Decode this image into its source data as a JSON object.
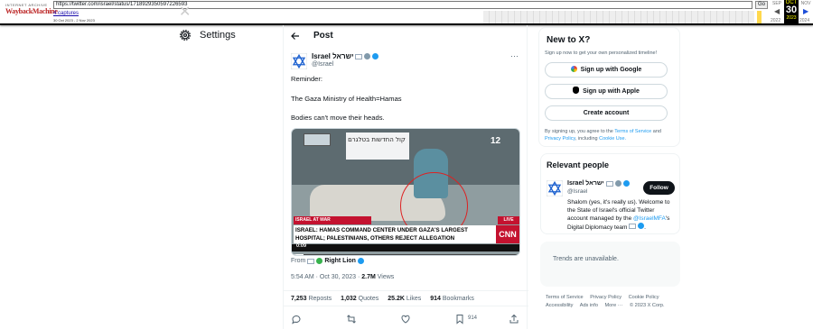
{
  "wayback": {
    "logo_top": "INTERNET ARCHIVE",
    "logo_main": "WaybackMachine",
    "url": "https://twitter.com/israel/status/1718929350597226593",
    "go_label": "Go",
    "captures": "4 captures",
    "range": "30 Oct 2023 - 2 Nov 2023",
    "cal": {
      "prev_month": "SEP",
      "cur_month": "OCT",
      "next_month": "NOV",
      "day": "30",
      "prev_year": "2022",
      "cur_year": "2023",
      "next_year": "2024"
    }
  },
  "left": {
    "settings_label": "Settings"
  },
  "post": {
    "header_title": "Post",
    "author_name": "Israel ישראל",
    "author_handle": "@Israel",
    "lines": [
      "Reminder:",
      "The Gaza Ministry of Health=Hamas",
      "Bodies can't move their heads."
    ],
    "media": {
      "hebrew_caption": "קול החדשות בטלגרם",
      "channel": "12",
      "war_banner": "ISRAEL AT WAR",
      "live": "LIVE",
      "headline": "ISRAEL: HAMAS COMMAND CENTER UNDER GAZA'S LARGEST HOSPITAL; PALESTINIANS, OTHERS REJECT ALLEGATION",
      "network": "CNN",
      "time": "0:09",
      "progress": 0.05
    },
    "from_label": "From",
    "from_source": "Right Lion",
    "time": "5:54 AM",
    "date": "Oct 30, 2023",
    "views_count": "2.7M",
    "views_label": "Views",
    "stats": [
      {
        "count": "7,253",
        "label": "Reposts"
      },
      {
        "count": "1,032",
        "label": "Quotes"
      },
      {
        "count": "25.2K",
        "label": "Likes"
      },
      {
        "count": "914",
        "label": "Bookmarks"
      }
    ],
    "bookmark_count": "914"
  },
  "signup": {
    "title": "New to X?",
    "subtitle": "Sign up now to get your own personalized timeline!",
    "google": "Sign up with Google",
    "apple": "Sign up with Apple",
    "create": "Create account",
    "fine_1": "By signing up, you agree to the",
    "fine_terms": "Terms of Service",
    "fine_2": "and",
    "fine_privacy": "Privacy Policy",
    "fine_3": ", including",
    "fine_cookie": "Cookie Use."
  },
  "people": {
    "title": "Relevant people",
    "name": "Israel ישראל",
    "handle": "@Israel",
    "follow": "Follow",
    "bio_1": "Shalom (yes, it's really us). Welcome to the State of Israel's official Twitter account managed by the",
    "bio_link": "@IsraelMFA",
    "bio_2": "'s Digital Diplomacy team"
  },
  "trends": {
    "text": "Trends are unavailable."
  },
  "footer": [
    "Terms of Service",
    "Privacy Policy",
    "Cookie Policy",
    "Accessibility",
    "Ads info",
    "More ···",
    "© 2023 X Corp."
  ],
  "colors": {
    "accent": "#1d9bf0",
    "text": "#0f1419",
    "muted": "#536471",
    "cnn_red": "#c4122f"
  }
}
